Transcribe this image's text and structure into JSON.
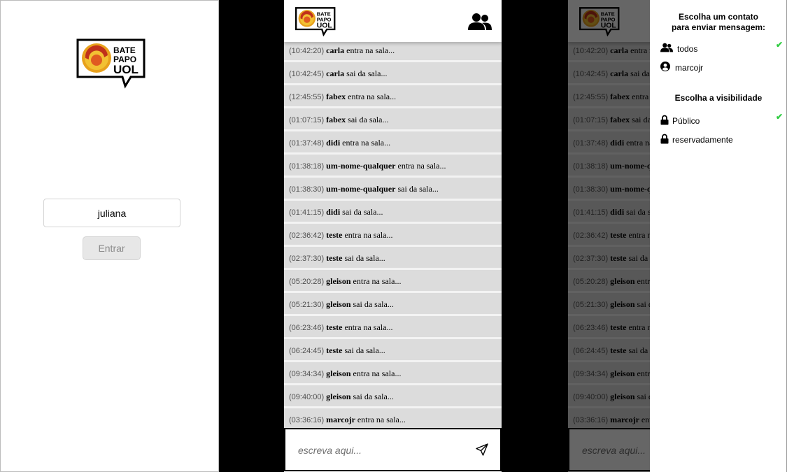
{
  "login": {
    "logo_words": [
      "BATE",
      "PAPO",
      "UOL"
    ],
    "name_value": "juliana",
    "enter_label": "Entrar"
  },
  "chat": {
    "logo_words": [
      "BATE",
      "PAPO",
      "UOL"
    ],
    "people_icon": "people-icon",
    "messages": [
      {
        "time": "(10:42:20)",
        "user": "carla",
        "text": "entra na sala..."
      },
      {
        "time": "(10:42:45)",
        "user": "carla",
        "text": "sai da sala..."
      },
      {
        "time": "(12:45:55)",
        "user": "fabex",
        "text": "entra na sala..."
      },
      {
        "time": "(01:07:15)",
        "user": "fabex",
        "text": "sai da sala..."
      },
      {
        "time": "(01:37:48)",
        "user": "didi",
        "text": "entra na sala..."
      },
      {
        "time": "(01:38:18)",
        "user": "um-nome-qualquer",
        "text": "entra na sala..."
      },
      {
        "time": "(01:38:30)",
        "user": "um-nome-qualquer",
        "text": "sai da sala..."
      },
      {
        "time": "(01:41:15)",
        "user": "didi",
        "text": "sai da sala..."
      },
      {
        "time": "(02:36:42)",
        "user": "teste",
        "text": "entra na sala..."
      },
      {
        "time": "(02:37:30)",
        "user": "teste",
        "text": "sai da sala..."
      },
      {
        "time": "(05:20:28)",
        "user": "gleison",
        "text": "entra na sala..."
      },
      {
        "time": "(05:21:30)",
        "user": "gleison",
        "text": "sai da sala..."
      },
      {
        "time": "(06:23:46)",
        "user": "teste",
        "text": "entra na sala..."
      },
      {
        "time": "(06:24:45)",
        "user": "teste",
        "text": "sai da sala..."
      },
      {
        "time": "(09:34:34)",
        "user": "gleison",
        "text": "entra na sala..."
      },
      {
        "time": "(09:40:00)",
        "user": "gleison",
        "text": "sai da sala..."
      },
      {
        "time": "(03:36:16)",
        "user": "marcojr",
        "text": "entra na sala..."
      }
    ],
    "input_placeholder": "escreva aqui...",
    "send_icon": "paper-plane-icon"
  },
  "sidemenu": {
    "contacts_heading_line1": "Escolha um contato",
    "contacts_heading_line2": "para enviar mensagem:",
    "contacts": [
      {
        "label": "todos",
        "icon": "people-icon",
        "selected": true
      },
      {
        "label": "marcojr",
        "icon": "user-circle-icon",
        "selected": false
      }
    ],
    "visibility_heading": "Escolha a visibilidade",
    "visibility": [
      {
        "label": "Público",
        "icon": "lock-open-icon",
        "selected": true
      },
      {
        "label": "reservadamente",
        "icon": "lock-icon",
        "selected": false
      }
    ],
    "check_mark": "✔",
    "check_color": "#2ecc40"
  }
}
